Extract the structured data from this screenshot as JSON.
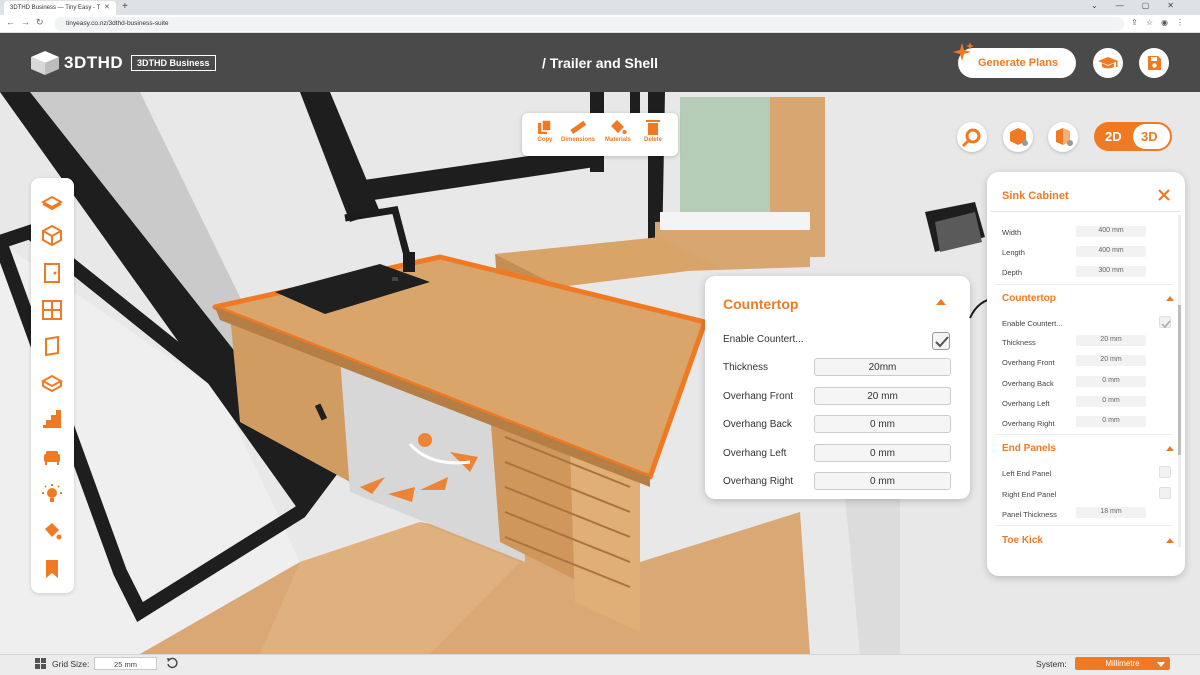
{
  "browser": {
    "tab_title": "3DTHD Business — Tiny Easy - T",
    "url": "tinyeasy.co.nz/3dthd-business-suite"
  },
  "header": {
    "logo_text": "3DTHD",
    "badge": "3DTHD Business",
    "title": "/ Trailer and Shell",
    "generate_label": "Generate Plans"
  },
  "actions": [
    {
      "label": "Copy"
    },
    {
      "label": "Dimensions"
    },
    {
      "label": "Materials"
    },
    {
      "label": "Delete"
    }
  ],
  "view_toggle": {
    "label_2d": "2D",
    "label_3d": "3D",
    "active": "3D"
  },
  "countertop_popup": {
    "title": "Countertop",
    "enable_label": "Enable Countert...",
    "enabled": true,
    "fields": [
      {
        "label": "Thickness",
        "value": "20mm"
      },
      {
        "label": "Overhang Front",
        "value": "20 mm"
      },
      {
        "label": "Overhang Back",
        "value": "0 mm"
      },
      {
        "label": "Overhang Left",
        "value": "0 mm"
      },
      {
        "label": "Overhang Right",
        "value": "0 mm"
      }
    ]
  },
  "panel": {
    "title": "Sink Cabinet",
    "dimensions": [
      {
        "label": "Width",
        "value": "400 mm"
      },
      {
        "label": "Length",
        "value": "400 mm"
      },
      {
        "label": "Depth",
        "value": "300 mm"
      }
    ],
    "countertop": {
      "title": "Countertop",
      "enable_label": "Enable Countert...",
      "fields": [
        {
          "label": "Thickness",
          "value": "20 mm"
        },
        {
          "label": "Overhang Front",
          "value": "20 mm"
        },
        {
          "label": "Overhang Back",
          "value": "0 mm"
        },
        {
          "label": "Overhang Left",
          "value": "0 mm"
        },
        {
          "label": "Overhang Right",
          "value": "0 mm"
        }
      ]
    },
    "end_panels": {
      "title": "End Panels",
      "left_label": "Left End Panel",
      "right_label": "Right End Panel",
      "thickness_label": "Panel Thickness",
      "thickness_value": "18 mm"
    },
    "toe_kick": {
      "title": "Toe Kick"
    }
  },
  "status": {
    "grid_label": "Grid Size:",
    "grid_value": "25 mm",
    "system_label": "System:",
    "system_value": "Millimetre"
  },
  "colors": {
    "accent": "#f07a23",
    "header": "#4a4a4a"
  }
}
